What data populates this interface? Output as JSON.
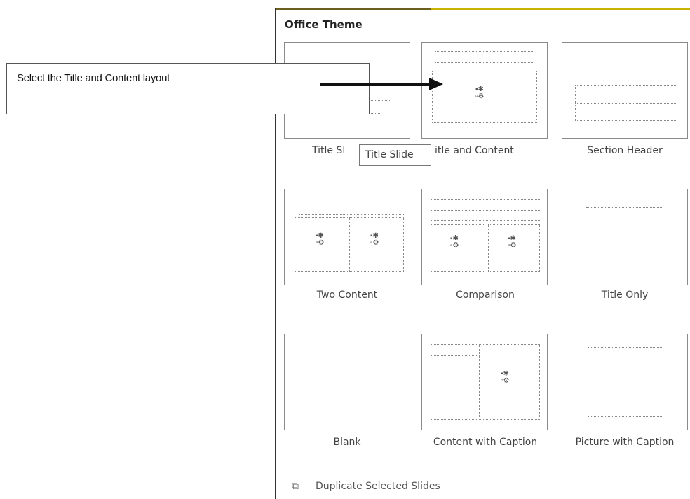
{
  "callout": {
    "text": "Select the Title and Content layout"
  },
  "panel": {
    "header": "Office Theme",
    "layouts": [
      {
        "label": "Title Slide",
        "visible_label": "Title Sl"
      },
      {
        "label": "Title and Content",
        "visible_label": "itle and Content"
      },
      {
        "label": "Section Header"
      },
      {
        "label": "Two Content"
      },
      {
        "label": "Comparison"
      },
      {
        "label": "Title Only"
      },
      {
        "label": "Blank"
      },
      {
        "label": "Content with Caption"
      },
      {
        "label": "Picture with Caption"
      }
    ],
    "tooltip": "Title Slide",
    "footer": {
      "duplicate_label": "Duplicate Selected Slides",
      "duplicate_icon": "duplicate-slides-icon"
    }
  },
  "colors": {
    "accent_line": "#c8b400",
    "border": "#8a8a8a"
  }
}
